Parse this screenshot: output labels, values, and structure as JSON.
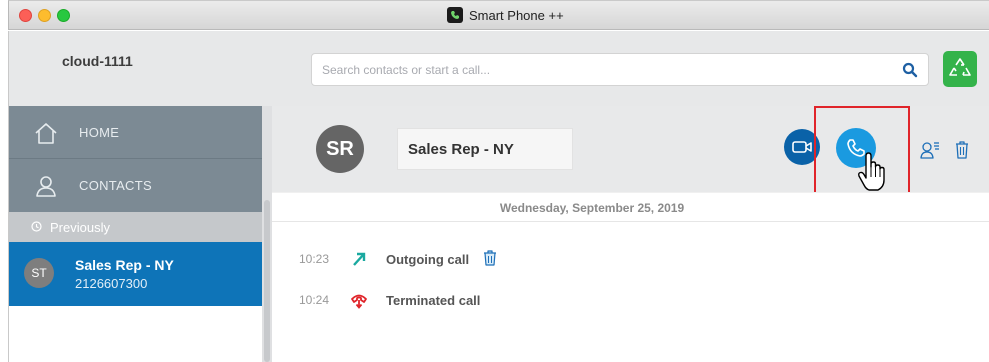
{
  "window": {
    "title": "Smart Phone ++"
  },
  "header": {
    "account": "cloud-1111",
    "search_placeholder": "Search contacts or start a call...",
    "brand_color": "#34b34a"
  },
  "sidebar": {
    "nav": [
      {
        "label": "HOME",
        "icon": "home-icon"
      },
      {
        "label": "CONTACTS",
        "icon": "user-icon"
      }
    ],
    "section_label": "Previously",
    "recent": [
      {
        "initials": "ST",
        "name": "Sales Rep - NY",
        "number": "2126607300",
        "selected": true
      }
    ],
    "selected_color": "#0e74b8"
  },
  "conversation": {
    "initials": "SR",
    "name": "Sales Rep - NY",
    "date": "Wednesday, September 25, 2019",
    "highlight_color": "#e0242a",
    "log": [
      {
        "time": "10:23",
        "text": "Outgoing call",
        "icon": "outgoing-arrow-icon"
      },
      {
        "time": "10:24",
        "text": "Terminated call",
        "icon": "terminated-call-icon"
      }
    ]
  }
}
